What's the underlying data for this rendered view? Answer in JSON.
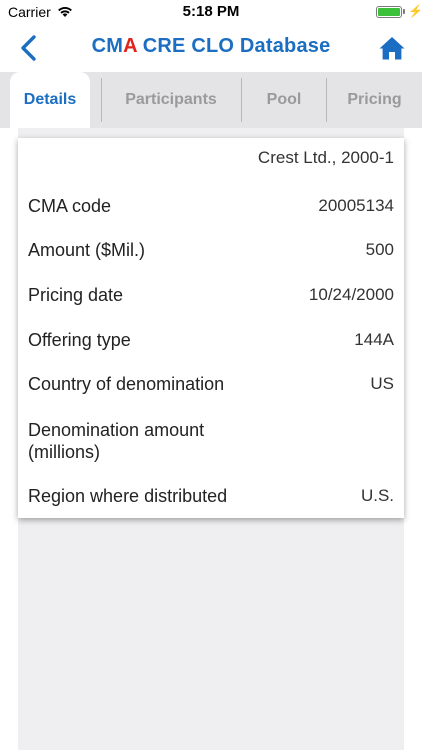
{
  "status": {
    "carrier": "Carrier",
    "time": "5:18 PM",
    "battery_level": 1.0,
    "battery_color": "#3cc13b"
  },
  "nav": {
    "title_part1": "CM",
    "title_accent": "A",
    "title_part2": " CRE CLO Database",
    "title_color": "#1b6ec2",
    "accent_color": "#e2231a",
    "back_icon": "chevron-left-icon",
    "home_icon": "home-icon"
  },
  "tabs": [
    {
      "label": "Details",
      "active": true
    },
    {
      "label": "Participants",
      "active": false
    },
    {
      "label": "Pool",
      "active": false
    },
    {
      "label": "Pricing",
      "active": false
    }
  ],
  "details": {
    "deal_name": "Crest Ltd., 2000-1",
    "rows": [
      {
        "label": "CMA code",
        "value": "20005134"
      },
      {
        "label": "Amount ($Mil.)",
        "value": "500"
      },
      {
        "label": "Pricing date",
        "value": "10/24/2000"
      },
      {
        "label": "Offering type",
        "value": "144A"
      },
      {
        "label": "Country of denomination",
        "value": "US"
      },
      {
        "label": "Denomination amount\n(millions)",
        "value": ""
      },
      {
        "label": "Region where distributed",
        "value": "U.S."
      }
    ]
  }
}
